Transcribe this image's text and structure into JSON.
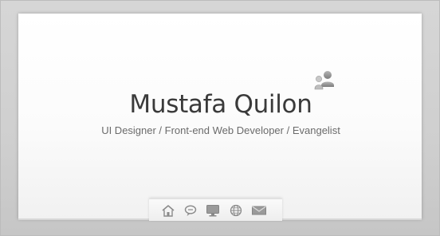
{
  "profile": {
    "name": "Mustafa Quilon",
    "tagline": "UI Designer / Front-end Web Developer / Evangelist"
  },
  "icons": {
    "avatar": "user-icon",
    "nav": [
      "home-icon",
      "speech-bubble-icon",
      "monitor-icon",
      "globe-icon",
      "mail-icon"
    ]
  },
  "colors": {
    "background": "#c9c9c9",
    "card": "#ffffff",
    "name_text": "#3a3a3a",
    "tagline_text": "#6b6b6b",
    "icon": "#8a8a8a"
  }
}
